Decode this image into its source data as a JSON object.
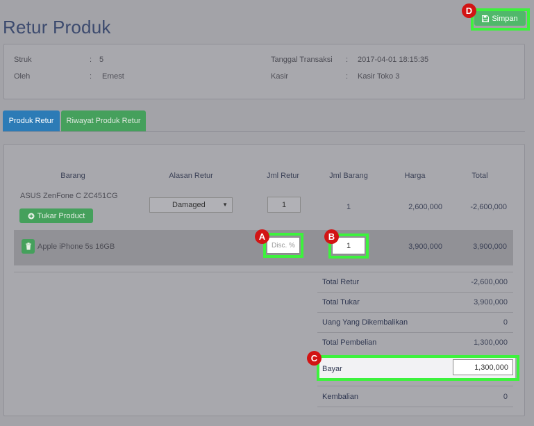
{
  "page_title": "Retur Produk",
  "save_button": "Simpan",
  "markers": {
    "a": "A",
    "b": "B",
    "c": "C",
    "d": "D"
  },
  "info": {
    "struk_label": "Struk",
    "struk_value": "5",
    "oleh_label": "Oleh",
    "oleh_value": "Ernest",
    "tanggal_label": "Tanggal Transaksi",
    "tanggal_value": "2017-04-01 18:15:35",
    "kasir_label": "Kasir",
    "kasir_value": "Kasir Toko 3",
    "separator": ":"
  },
  "tabs": {
    "produk_retur": "Produk Retur",
    "riwayat": "Riwayat Produk Retur"
  },
  "table": {
    "headers": {
      "barang": "Barang",
      "alasan": "Alasan Retur",
      "jml_retur": "Jml Retur",
      "jml_barang": "Jml Barang",
      "harga": "Harga",
      "total": "Total"
    },
    "row1": {
      "barang": "ASUS ZenFone C ZC451CG",
      "alasan": "Damaged",
      "jml_retur": "1",
      "jml_barang": "1",
      "harga": "2,600,000",
      "total": "-2,600,000",
      "tukar_button": "Tukar Product"
    },
    "row2": {
      "barang": "Apple iPhone 5s 16GB",
      "disc_placeholder": "Disc. %",
      "jml_barang": "1",
      "harga": "3,900,000",
      "total": "3,900,000"
    }
  },
  "summary": {
    "total_retur_label": "Total Retur",
    "total_retur_value": "-2,600,000",
    "total_tukar_label": "Total Tukar",
    "total_tukar_value": "3,900,000",
    "uang_label": "Uang Yang Dikembalikan",
    "uang_value": "0",
    "total_pembelian_label": "Total Pembelian",
    "total_pembelian_value": "1,300,000",
    "bayar_label": "Bayar",
    "bayar_value": "1,300,000",
    "kembalian_label": "Kembalian",
    "kembalian_value": "0"
  },
  "colors": {
    "highlight": "#3df23d",
    "marker": "#d21414",
    "primary": "#2c7bb6",
    "success": "#45a05c"
  }
}
